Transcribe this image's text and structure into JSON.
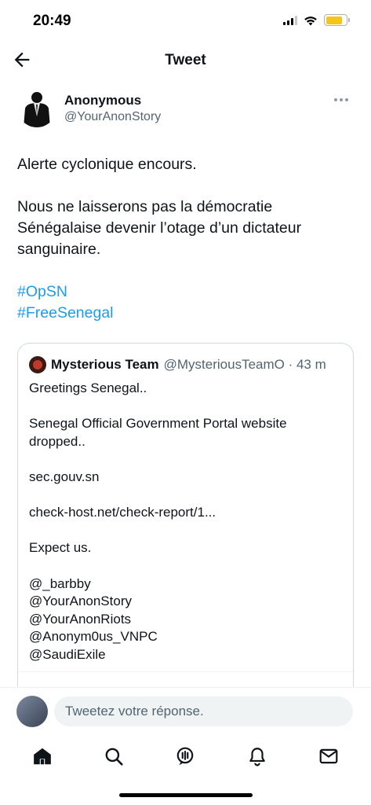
{
  "status_bar": {
    "time": "20:49"
  },
  "header": {
    "title": "Tweet"
  },
  "tweet": {
    "author_name": "Anonymous",
    "author_handle": "@YourAnonStory",
    "paragraph_1": "Alerte cyclonique encours.",
    "paragraph_2": "Nous ne laisserons pas la démocratie Sénégalaise devenir l’otage d’un dictateur sanguinaire.",
    "hashtags": [
      "#OpSN",
      "#FreeSenegal"
    ]
  },
  "quoted_tweet": {
    "author_name": "Mysterious Team",
    "author_handle": "@MysteriousTeamO · 43 m",
    "lines": [
      "Greetings Senegal..",
      "",
      "Senegal Official Government Portal website dropped..",
      "",
      "sec.gouv.sn",
      "",
      "check-host.net/check-report/1...",
      "",
      "Expect us.",
      "",
      "@_barbby",
      "@YourAnonStory",
      "@YourAnonRiots",
      "@Anonym0us_VNPC",
      "@SaudiExile"
    ]
  },
  "reply": {
    "placeholder": "Tweetez votre réponse."
  },
  "tab_bar": {
    "icons": [
      "home-icon",
      "search-icon",
      "spaces-icon",
      "notifications-icon",
      "messages-icon"
    ]
  },
  "colors": {
    "link": "#1d9bf0",
    "secondary_text": "#536471",
    "battery": "#f5c518"
  }
}
